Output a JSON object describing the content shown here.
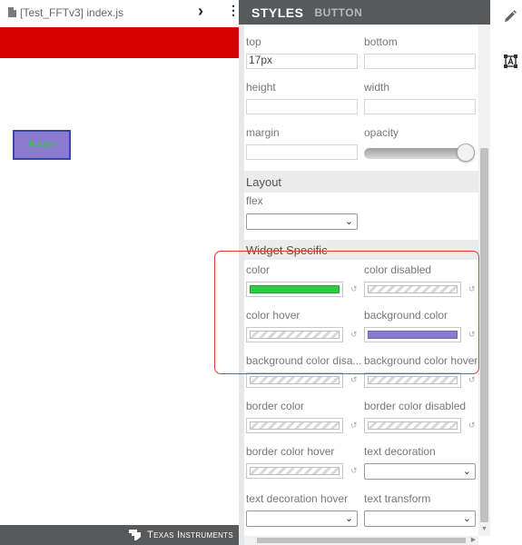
{
  "editor": {
    "file_title": "[Test_FFTv3] index.js",
    "chevron": "›",
    "more": "⋮"
  },
  "preview": {
    "button_label": "Button",
    "footer_brand": "Texas Instruments"
  },
  "panel": {
    "title": "STYLES",
    "subtitle": "BUTTON",
    "fields": {
      "top": {
        "label": "top",
        "value": "17px"
      },
      "bottom": {
        "label": "bottom",
        "value": ""
      },
      "height": {
        "label": "height",
        "value": ""
      },
      "width": {
        "label": "width",
        "value": ""
      },
      "margin": {
        "label": "margin",
        "value": ""
      },
      "opacity": {
        "label": "opacity",
        "level": 1.0
      }
    },
    "layout": {
      "title": "Layout",
      "flex": {
        "label": "flex",
        "value": ""
      }
    },
    "widget": {
      "title": "Widget Specific",
      "color": {
        "label": "color",
        "value": "#2ecc40"
      },
      "color_disabled": {
        "label": "color disabled",
        "value": ""
      },
      "color_hover": {
        "label": "color hover",
        "value": ""
      },
      "background_color": {
        "label": "background color",
        "value": "#8a7bcf"
      },
      "background_color_disabled": {
        "label": "background color disa..."
      },
      "background_color_hover": {
        "label": "background color hover"
      },
      "border_color": {
        "label": "border color"
      },
      "border_color_disabled": {
        "label": "border color disabled"
      },
      "border_color_hover": {
        "label": "border color hover"
      },
      "text_decoration": {
        "label": "text decoration",
        "value": ""
      },
      "text_decoration_hover": {
        "label": "text decoration hover",
        "value": ""
      },
      "text_transform": {
        "label": "text transform",
        "value": ""
      }
    },
    "reset_glyph": "↺"
  },
  "toolbar": {
    "edit_icon": "pencil-icon",
    "select_icon": "select-text-icon"
  },
  "colors": {
    "header_bg": "#58595b",
    "banner_red": "#d40000",
    "highlight": "#e03a3a"
  }
}
